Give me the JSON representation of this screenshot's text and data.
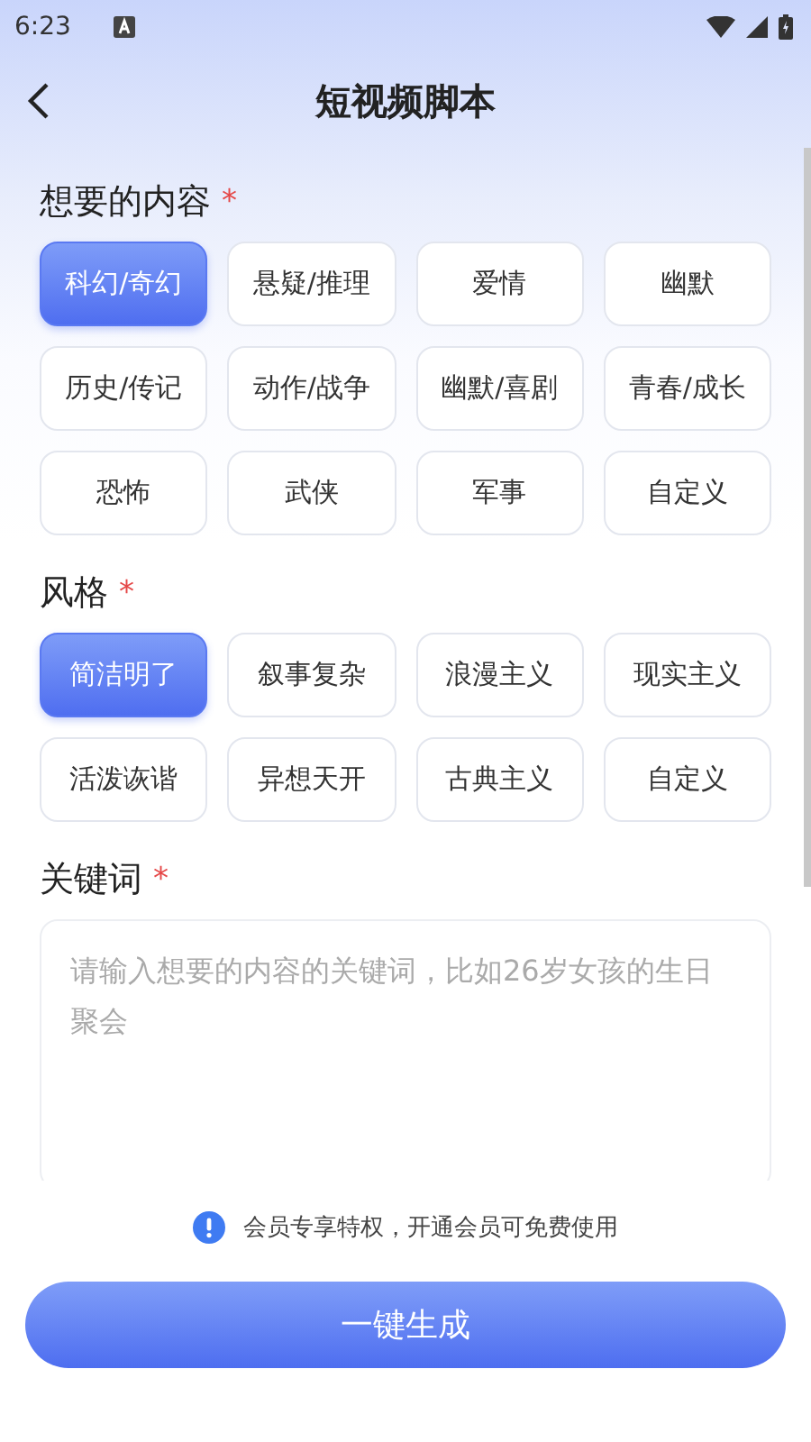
{
  "status_bar": {
    "time": "6:23"
  },
  "header": {
    "title": "短视频脚本"
  },
  "sections": [
    {
      "title": "想要的内容",
      "required_mark": "*",
      "options": [
        {
          "label": "科幻/奇幻",
          "selected": true
        },
        {
          "label": "悬疑/推理",
          "selected": false
        },
        {
          "label": "爱情",
          "selected": false
        },
        {
          "label": "幽默",
          "selected": false
        },
        {
          "label": "历史/传记",
          "selected": false
        },
        {
          "label": "动作/战争",
          "selected": false
        },
        {
          "label": "幽默/喜剧",
          "selected": false
        },
        {
          "label": "青春/成长",
          "selected": false
        },
        {
          "label": "恐怖",
          "selected": false
        },
        {
          "label": "武侠",
          "selected": false
        },
        {
          "label": "军事",
          "selected": false
        },
        {
          "label": "自定义",
          "selected": false
        }
      ]
    },
    {
      "title": "风格",
      "required_mark": "*",
      "options": [
        {
          "label": "简洁明了",
          "selected": true
        },
        {
          "label": "叙事复杂",
          "selected": false
        },
        {
          "label": "浪漫主义",
          "selected": false
        },
        {
          "label": "现实主义",
          "selected": false
        },
        {
          "label": "活泼诙谐",
          "selected": false
        },
        {
          "label": "异想天开",
          "selected": false
        },
        {
          "label": "古典主义",
          "selected": false
        },
        {
          "label": "自定义",
          "selected": false
        }
      ]
    }
  ],
  "keywords": {
    "title": "关键词",
    "required_mark": "*",
    "placeholder": "请输入想要的内容的关键词，比如26岁女孩的生日聚会"
  },
  "notice": "会员专享特权，开通会员可免费使用",
  "generate_button": "一键生成"
}
